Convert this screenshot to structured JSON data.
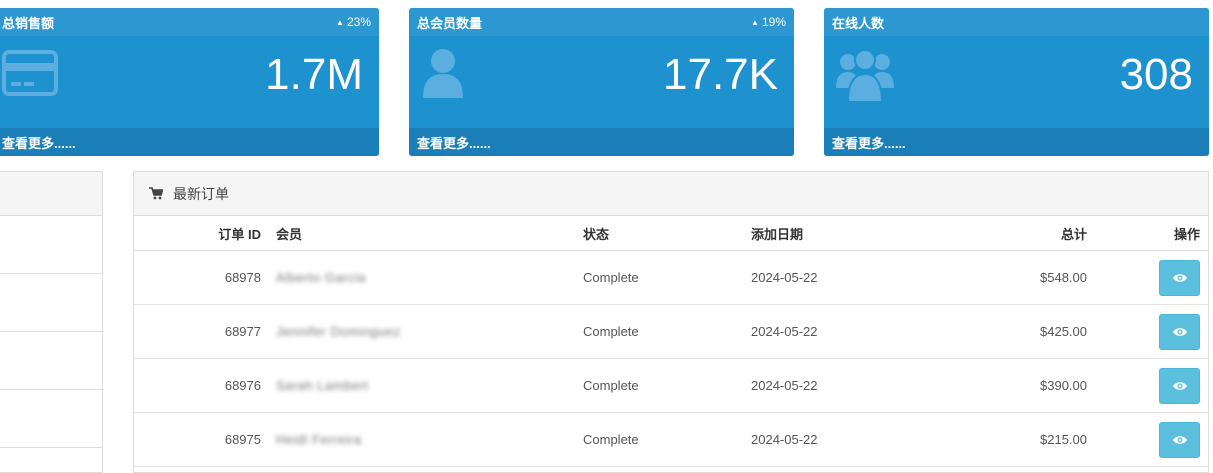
{
  "tiles": [
    {
      "title": "总销售额",
      "delta": "23%",
      "value": "1.7M",
      "footer": "查看更多......",
      "icon": "credit-card-icon"
    },
    {
      "title": "总会员数量",
      "delta": "19%",
      "value": "17.7K",
      "footer": "查看更多......",
      "icon": "user-icon"
    },
    {
      "title": "在线人数",
      "delta": "",
      "value": "308",
      "footer": "查看更多......",
      "icon": "users-icon"
    }
  ],
  "orders": {
    "title": "最新订单",
    "icon": "shopping-cart-icon",
    "columns": {
      "id": "订单 ID",
      "member": "会员",
      "status": "状态",
      "date": "添加日期",
      "total": "总计",
      "action": "操作"
    },
    "rows": [
      {
        "id": "68978",
        "member": "Alberto Garcia",
        "status": "Complete",
        "date": "2024-05-22",
        "total": "$548.00"
      },
      {
        "id": "68977",
        "member": "Jennifer Dominguez",
        "status": "Complete",
        "date": "2024-05-22",
        "total": "$425.00"
      },
      {
        "id": "68976",
        "member": "Sarah Lambert",
        "status": "Complete",
        "date": "2024-05-22",
        "total": "$390.00"
      },
      {
        "id": "68975",
        "member": "Heidi Ferreira",
        "status": "Complete",
        "date": "2024-05-22",
        "total": "$215.00"
      }
    ],
    "action_icon": "eye-icon"
  },
  "colors": {
    "tile_bg": "#1e91cf",
    "tile_footer": "#1a7fb8",
    "view_button": "#5bc0de"
  }
}
